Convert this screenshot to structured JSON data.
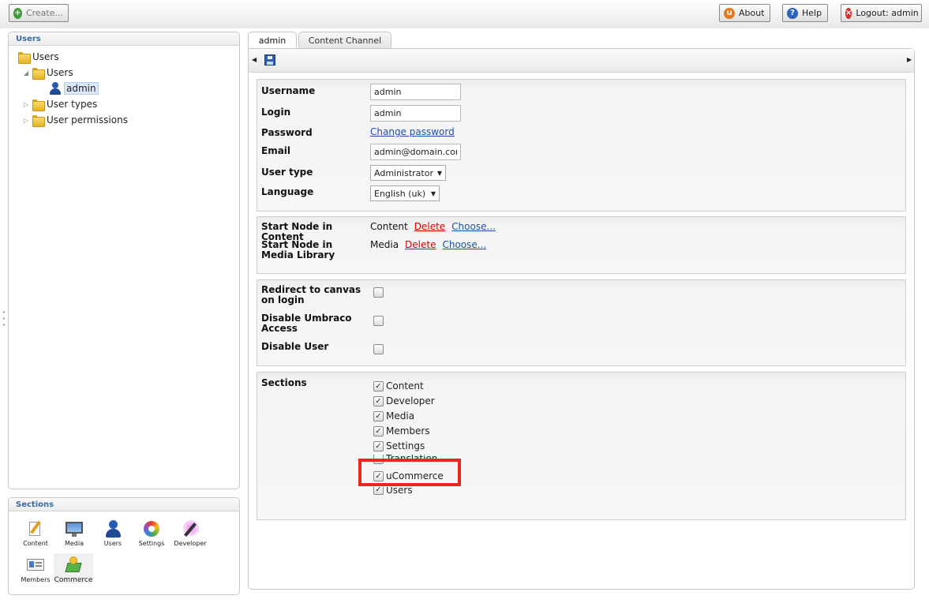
{
  "topbar": {
    "create_label": "Create...",
    "about_label": "About",
    "help_label": "Help",
    "logout_label": "Logout: admin"
  },
  "users_panel": {
    "title": "Users",
    "tree": [
      {
        "label": "Users"
      },
      {
        "label": "Users"
      },
      {
        "label": "admin"
      },
      {
        "label": "User types"
      },
      {
        "label": "User permissions"
      }
    ]
  },
  "sections_panel": {
    "title": "Sections",
    "items": [
      {
        "label": "Content",
        "icon": "pencil-document-icon"
      },
      {
        "label": "Media",
        "icon": "monitor-image-icon"
      },
      {
        "label": "Users",
        "icon": "user-icon"
      },
      {
        "label": "Settings",
        "icon": "color-wheel-icon"
      },
      {
        "label": "Developer",
        "icon": "magic-wand-icon"
      },
      {
        "label": "Members",
        "icon": "member-card-icon"
      },
      {
        "label": "Commerce",
        "icon": "money-stack-icon"
      }
    ]
  },
  "tabs": [
    {
      "label": "admin",
      "active": true
    },
    {
      "label": "Content Channel",
      "active": false
    }
  ],
  "form": {
    "username": {
      "label": "Username",
      "value": "admin"
    },
    "login": {
      "label": "Login",
      "value": "admin"
    },
    "password": {
      "label": "Password",
      "link": "Change password"
    },
    "email": {
      "label": "Email",
      "value": "admin@domain.com"
    },
    "user_type": {
      "label": "User type",
      "value": "Administrator"
    },
    "language": {
      "label": "Language",
      "value": "English (uk)"
    },
    "start_content": {
      "label": "Start Node in Content",
      "value": "Content",
      "delete": "Delete",
      "choose": "Choose..."
    },
    "start_media": {
      "label": "Start Node in Media Library",
      "value": "Media",
      "delete": "Delete",
      "choose": "Choose..."
    },
    "redirect": {
      "label": "Redirect to canvas on login",
      "checked": false
    },
    "disable_umbraco": {
      "label": "Disable Umbraco Access",
      "checked": false
    },
    "disable_user": {
      "label": "Disable User",
      "checked": false
    },
    "sections": {
      "label": "Sections",
      "items": [
        {
          "label": "Content",
          "checked": true
        },
        {
          "label": "Developer",
          "checked": true
        },
        {
          "label": "Media",
          "checked": true
        },
        {
          "label": "Members",
          "checked": true
        },
        {
          "label": "Settings",
          "checked": true
        },
        {
          "label": "Translation",
          "checked": false
        },
        {
          "label": "uCommerce",
          "checked": true
        },
        {
          "label": "Users",
          "checked": true
        }
      ]
    }
  },
  "colors": {
    "highlight": "#e8281e",
    "link": "#1f4fa8",
    "delete_link": "#d40000",
    "panel_title": "#3a6aa4"
  }
}
